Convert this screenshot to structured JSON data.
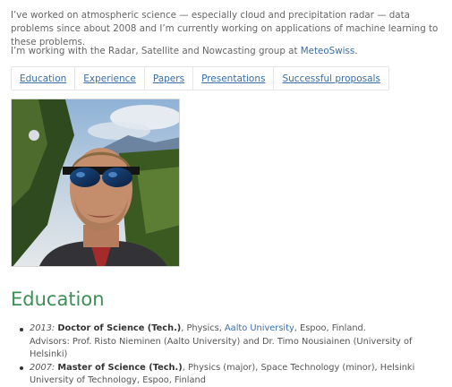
{
  "intro": {
    "text": "I’ve worked on atmospheric science — especially cloud and precipitation radar — data problems since about 2008 and I’m currently working on applications of machine learning to these problems."
  },
  "group": {
    "prefix": "I’m working with the Radar, Satellite and Nowcasting group at ",
    "link": "MeteoSwiss",
    "suffix": "."
  },
  "tabs": [
    "Education",
    "Experience",
    "Papers",
    "Presentations",
    "Successful proposals"
  ],
  "education": {
    "title": "Education",
    "items": [
      {
        "year": "2013:",
        "degree": "Doctor of Science (Tech.)",
        "sep1": ", Physics, ",
        "university": "Aalto University",
        "rest": ", Espoo, Finland.",
        "advisors": "Advisors: Prof. Risto Nieminen (Aalto University) and Dr. Timo Nousiainen (University of Helsinki)"
      },
      {
        "year": "2007:",
        "degree": "Master of Science (Tech.)",
        "rest": ", Physics (major), Space Technology (minor), Helsinki University of Technology, Espoo, Finland"
      }
    ]
  },
  "colors": {
    "link": "#3a6ea8",
    "heading": "#3c8f56",
    "text": "#555555"
  }
}
